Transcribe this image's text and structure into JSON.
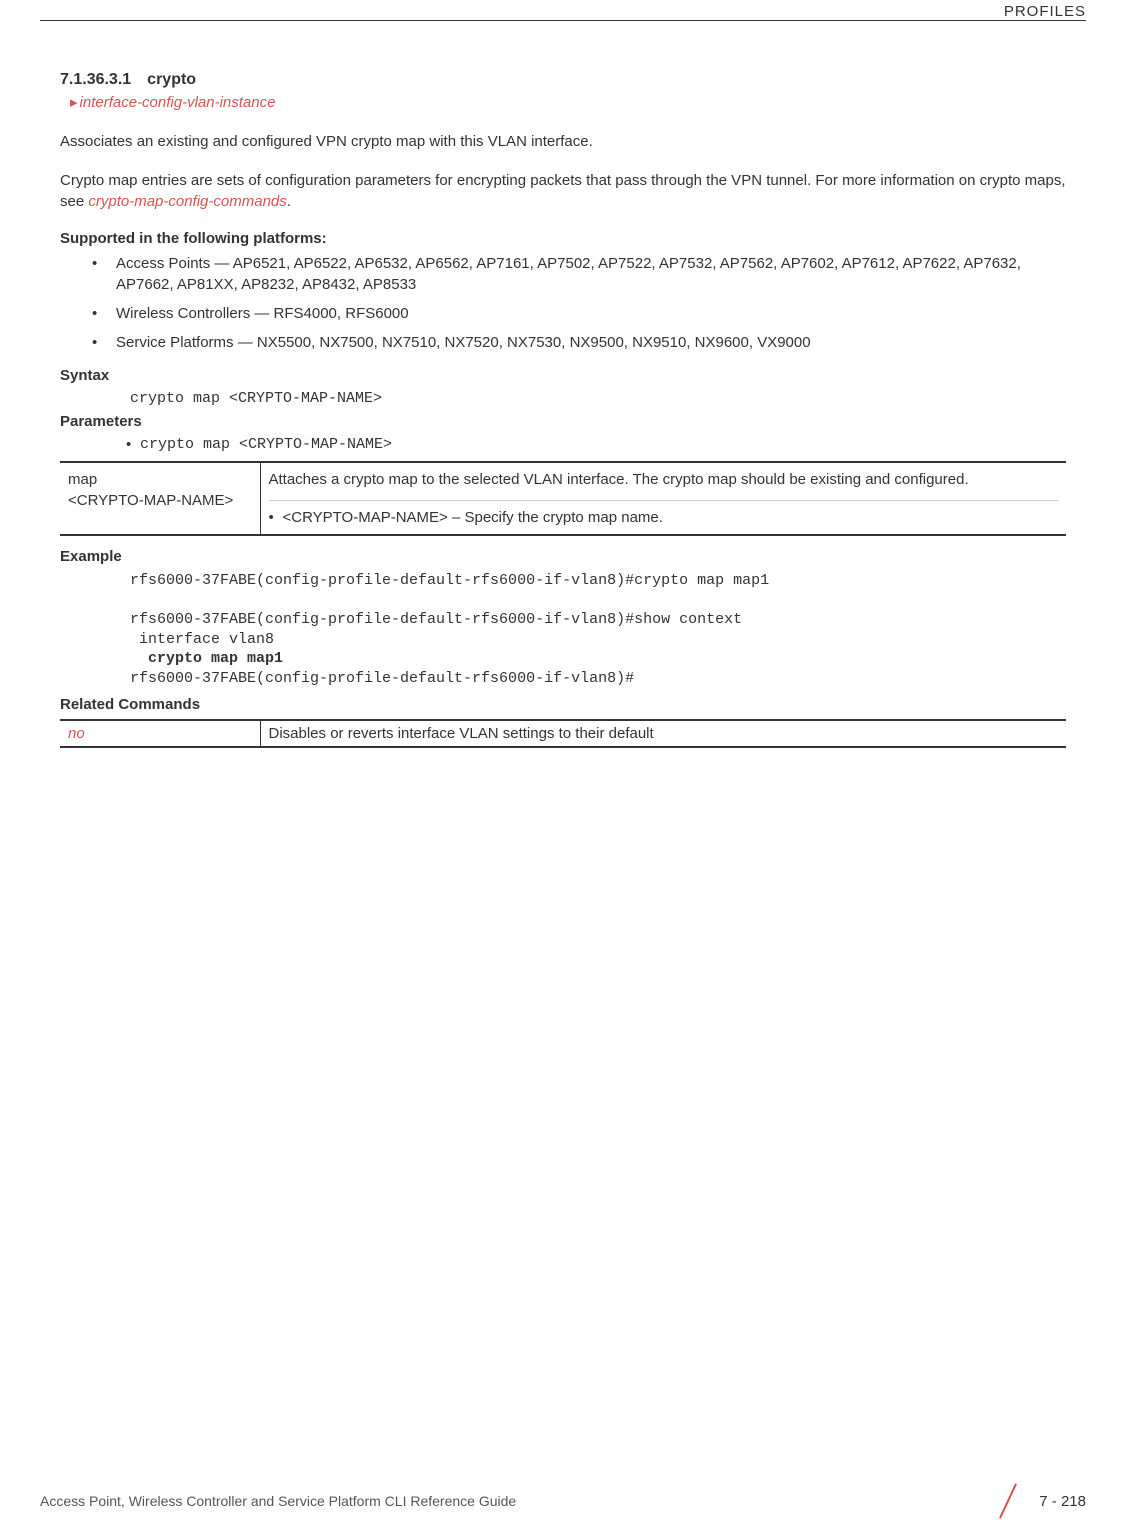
{
  "header": {
    "category": "PROFILES"
  },
  "section": {
    "number": "7.1.36.3.1",
    "title": "crypto",
    "breadcrumb": "interface-config-vlan-instance"
  },
  "intro": {
    "p1": "Associates an existing and configured VPN crypto map with this VLAN interface.",
    "p2_prefix": "Crypto map entries are sets of configuration parameters for encrypting packets that pass through the VPN tunnel. For more information on crypto maps, see ",
    "p2_link": "crypto-map-config-commands",
    "p2_suffix": "."
  },
  "platforms": {
    "heading": "Supported in the following platforms:",
    "items": [
      "Access Points — AP6521, AP6522, AP6532, AP6562, AP7161, AP7502, AP7522, AP7532, AP7562, AP7602, AP7612, AP7622, AP7632, AP7662, AP81XX, AP8232, AP8432, AP8533",
      "Wireless Controllers — RFS4000, RFS6000",
      "Service Platforms — NX5500, NX7500, NX7510, NX7520, NX7530, NX9500, NX9510, NX9600, VX9000"
    ]
  },
  "syntax": {
    "heading": "Syntax",
    "code": "crypto map <CRYPTO-MAP-NAME>"
  },
  "parameters": {
    "heading": "Parameters",
    "bullet": "crypto map <CRYPTO-MAP-NAME>",
    "table": {
      "col1_line1": "map",
      "col1_line2": "<CRYPTO-MAP-NAME>",
      "col2_main": "Attaches a crypto map to the selected VLAN interface. The crypto map should be existing and configured.",
      "col2_sub": "<CRYPTO-MAP-NAME> – Specify the crypto map name."
    }
  },
  "example": {
    "heading": "Example",
    "line1": "rfs6000-37FABE(config-profile-default-rfs6000-if-vlan8)#crypto map map1",
    "line2": "rfs6000-37FABE(config-profile-default-rfs6000-if-vlan8)#show context",
    "line3": " interface vlan8",
    "line4_bold": "  crypto map map1",
    "line5": "rfs6000-37FABE(config-profile-default-rfs6000-if-vlan8)#"
  },
  "related": {
    "heading": "Related Commands",
    "table": {
      "cmd": "no",
      "desc": "Disables or reverts interface VLAN settings to their default"
    }
  },
  "footer": {
    "title": "Access Point, Wireless Controller and Service Platform CLI Reference Guide",
    "page": "7 - 218"
  }
}
